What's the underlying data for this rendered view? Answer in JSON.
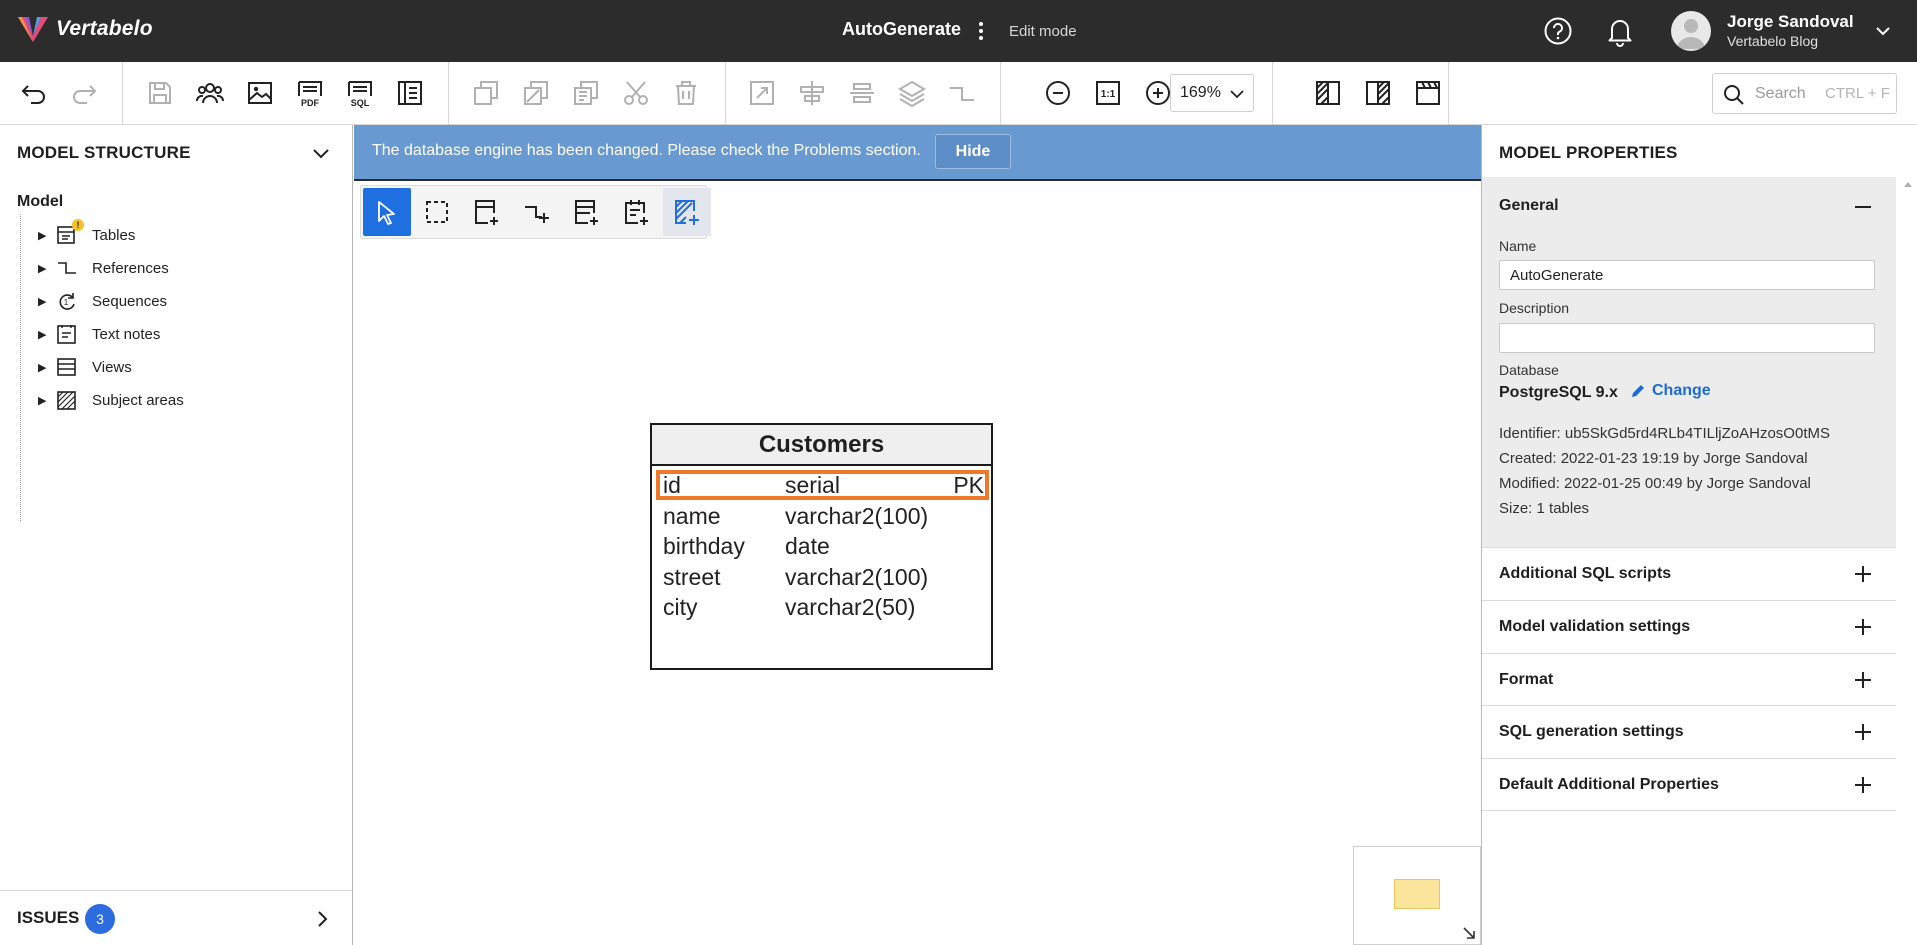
{
  "app": {
    "logo_text": "Vertabelo",
    "document_title": "AutoGenerate",
    "mode": "Edit mode",
    "user": {
      "name": "Jorge Sandoval",
      "org": "Vertabelo Blog"
    }
  },
  "toolbar": {
    "zoom": "169%",
    "search_placeholder": "Search",
    "search_shortcut": "CTRL + F",
    "pdf_label": "PDF",
    "sql_label": "SQL",
    "one_to_one_label": "1:1"
  },
  "left_panel": {
    "title": "MODEL STRUCTURE",
    "root": "Model",
    "items": [
      {
        "label": "Tables",
        "icon": "table-icon",
        "warning": true
      },
      {
        "label": "References",
        "icon": "reference-icon"
      },
      {
        "label": "Sequences",
        "icon": "sequence-icon"
      },
      {
        "label": "Text notes",
        "icon": "text-note-icon"
      },
      {
        "label": "Views",
        "icon": "view-icon"
      },
      {
        "label": "Subject areas",
        "icon": "subject-area-icon"
      }
    ],
    "issues_label": "ISSUES",
    "issues_count": "3"
  },
  "canvas": {
    "banner_text": "The database engine has been changed. Please check the Problems section.",
    "banner_button": "Hide",
    "table": {
      "name": "Customers",
      "columns": [
        {
          "name": "id",
          "type": "serial",
          "key": "PK",
          "selected": true
        },
        {
          "name": "name",
          "type": "varchar2(100)",
          "key": ""
        },
        {
          "name": "birthday",
          "type": "date",
          "key": ""
        },
        {
          "name": "street",
          "type": "varchar2(100)",
          "key": ""
        },
        {
          "name": "city",
          "type": "varchar2(50)",
          "key": ""
        }
      ]
    }
  },
  "right_panel": {
    "title": "MODEL PROPERTIES",
    "general": {
      "title": "General",
      "name_label": "Name",
      "name_value": "AutoGenerate",
      "description_label": "Description",
      "description_value": "",
      "database_label": "Database",
      "database_value": "PostgreSQL 9.x",
      "change_label": "Change",
      "identifier": "Identifier: ub5SkGd5rd4RLb4TILljZoAHzosO0tMS",
      "created": "Created: 2022-01-23 19:19 by Jorge Sandoval",
      "modified": "Modified: 2022-01-25 00:49 by Jorge Sandoval",
      "size": "Size: 1 tables"
    },
    "sections": [
      "Additional SQL scripts",
      "Model validation settings",
      "Format",
      "SQL generation settings",
      "Default Additional Properties"
    ]
  },
  "colors": {
    "topbar": "#2c2c2c",
    "banner": "#6999d1",
    "accent": "#1e6fe0",
    "selection": "#f0782a",
    "warning": "#f6c02a"
  }
}
